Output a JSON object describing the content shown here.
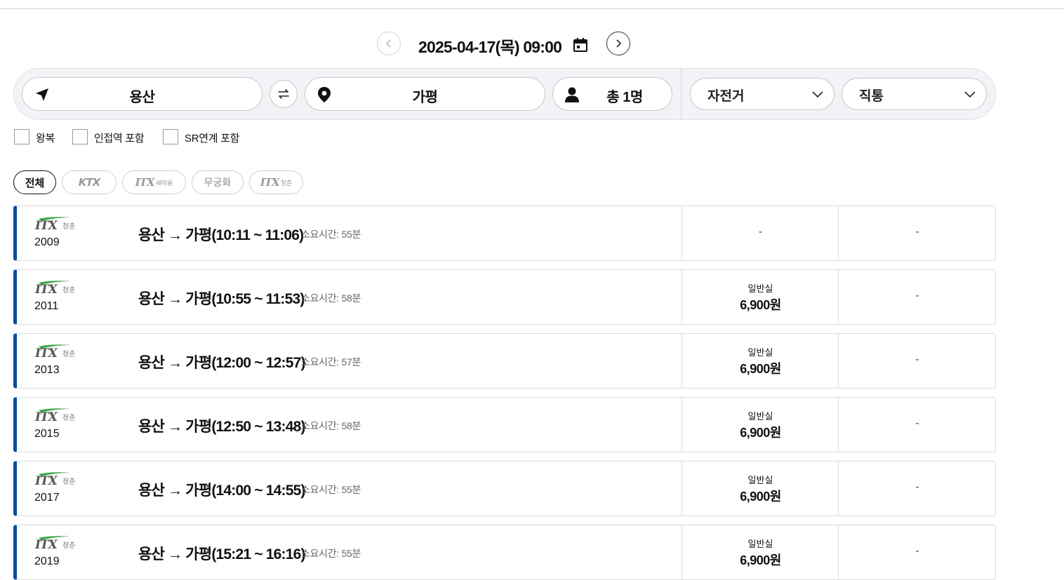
{
  "header": {
    "date_label": "2025-04-17(목) 09:00"
  },
  "search": {
    "origin": "용산",
    "destination": "가평",
    "passengers": "총 1명",
    "bike_option": "자전거",
    "route_option": "직통"
  },
  "options": [
    {
      "label": "왕복",
      "checked": false
    },
    {
      "label": "인접역 포함",
      "checked": false
    },
    {
      "label": "SR연계 포함",
      "checked": false
    }
  ],
  "filters": {
    "all": "전체",
    "ktx": "KTX",
    "itx_saemaeul": "ITX",
    "itx_saemaeul_sub": "새마을",
    "mugunghwa": "무궁화",
    "itx_cheongchun": "ITX",
    "itx_cheongchun_sub": "청춘"
  },
  "trains": [
    {
      "brand": "ITX",
      "brand_sub": "청춘",
      "number": "2009",
      "route": "용산 → 가평(10:11 ~ 11:06)",
      "duration": "소요시간: 55분",
      "col1_class": "",
      "col1_price": "",
      "col1_dash": "-",
      "col2": "-"
    },
    {
      "brand": "ITX",
      "brand_sub": "청춘",
      "number": "2011",
      "route": "용산 → 가평(10:55 ~ 11:53)",
      "duration": "소요시간: 58분",
      "col1_class": "일반실",
      "col1_price": "6,900원",
      "col1_dash": "",
      "col2": "-"
    },
    {
      "brand": "ITX",
      "brand_sub": "청춘",
      "number": "2013",
      "route": "용산 → 가평(12:00 ~ 12:57)",
      "duration": "소요시간: 57분",
      "col1_class": "일반실",
      "col1_price": "6,900원",
      "col1_dash": "",
      "col2": "-"
    },
    {
      "brand": "ITX",
      "brand_sub": "청춘",
      "number": "2015",
      "route": "용산 → 가평(12:50 ~ 13:48)",
      "duration": "소요시간: 58분",
      "col1_class": "일반실",
      "col1_price": "6,900원",
      "col1_dash": "",
      "col2": "-"
    },
    {
      "brand": "ITX",
      "brand_sub": "청춘",
      "number": "2017",
      "route": "용산 → 가평(14:00 ~ 14:55)",
      "duration": "소요시간: 55분",
      "col1_class": "일반실",
      "col1_price": "6,900원",
      "col1_dash": "",
      "col2": "-"
    },
    {
      "brand": "ITX",
      "brand_sub": "청춘",
      "number": "2019",
      "route": "용산 → 가평(15:21 ~ 16:16)",
      "duration": "소요시간: 55분",
      "col1_class": "일반실",
      "col1_price": "6,900원",
      "col1_dash": "",
      "col2": "-"
    }
  ],
  "colors": {
    "accent": "#0a4aa0",
    "itx_green": "#3aa54a",
    "border": "#dcdcdc"
  }
}
